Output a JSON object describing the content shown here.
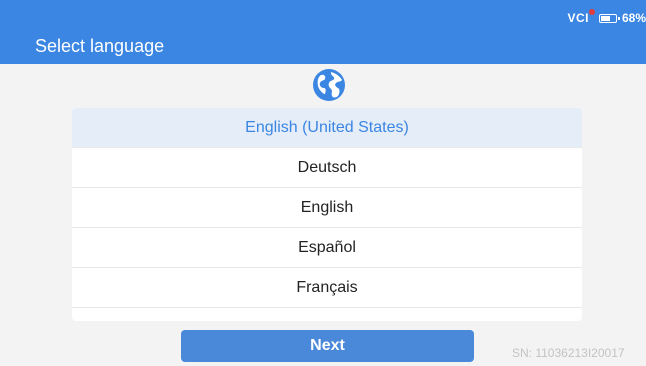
{
  "header": {
    "title": "Select language",
    "vci_label": "VCI",
    "battery_percent_label": "68%",
    "battery_level": 0.68
  },
  "globe_icon": "globe-icon",
  "languages": [
    {
      "label": "English (United States)",
      "selected": true
    },
    {
      "label": "Deutsch",
      "selected": false
    },
    {
      "label": "English",
      "selected": false
    },
    {
      "label": "Español",
      "selected": false
    },
    {
      "label": "Français",
      "selected": false
    }
  ],
  "next_label": "Next",
  "serial": "SN: 11036213I20017",
  "colors": {
    "header": "#3b86e2",
    "accent": "#3b86e2",
    "selected_bg": "#e5edf9",
    "button": "#4a88da",
    "vci_dot": "#e23b3b"
  }
}
